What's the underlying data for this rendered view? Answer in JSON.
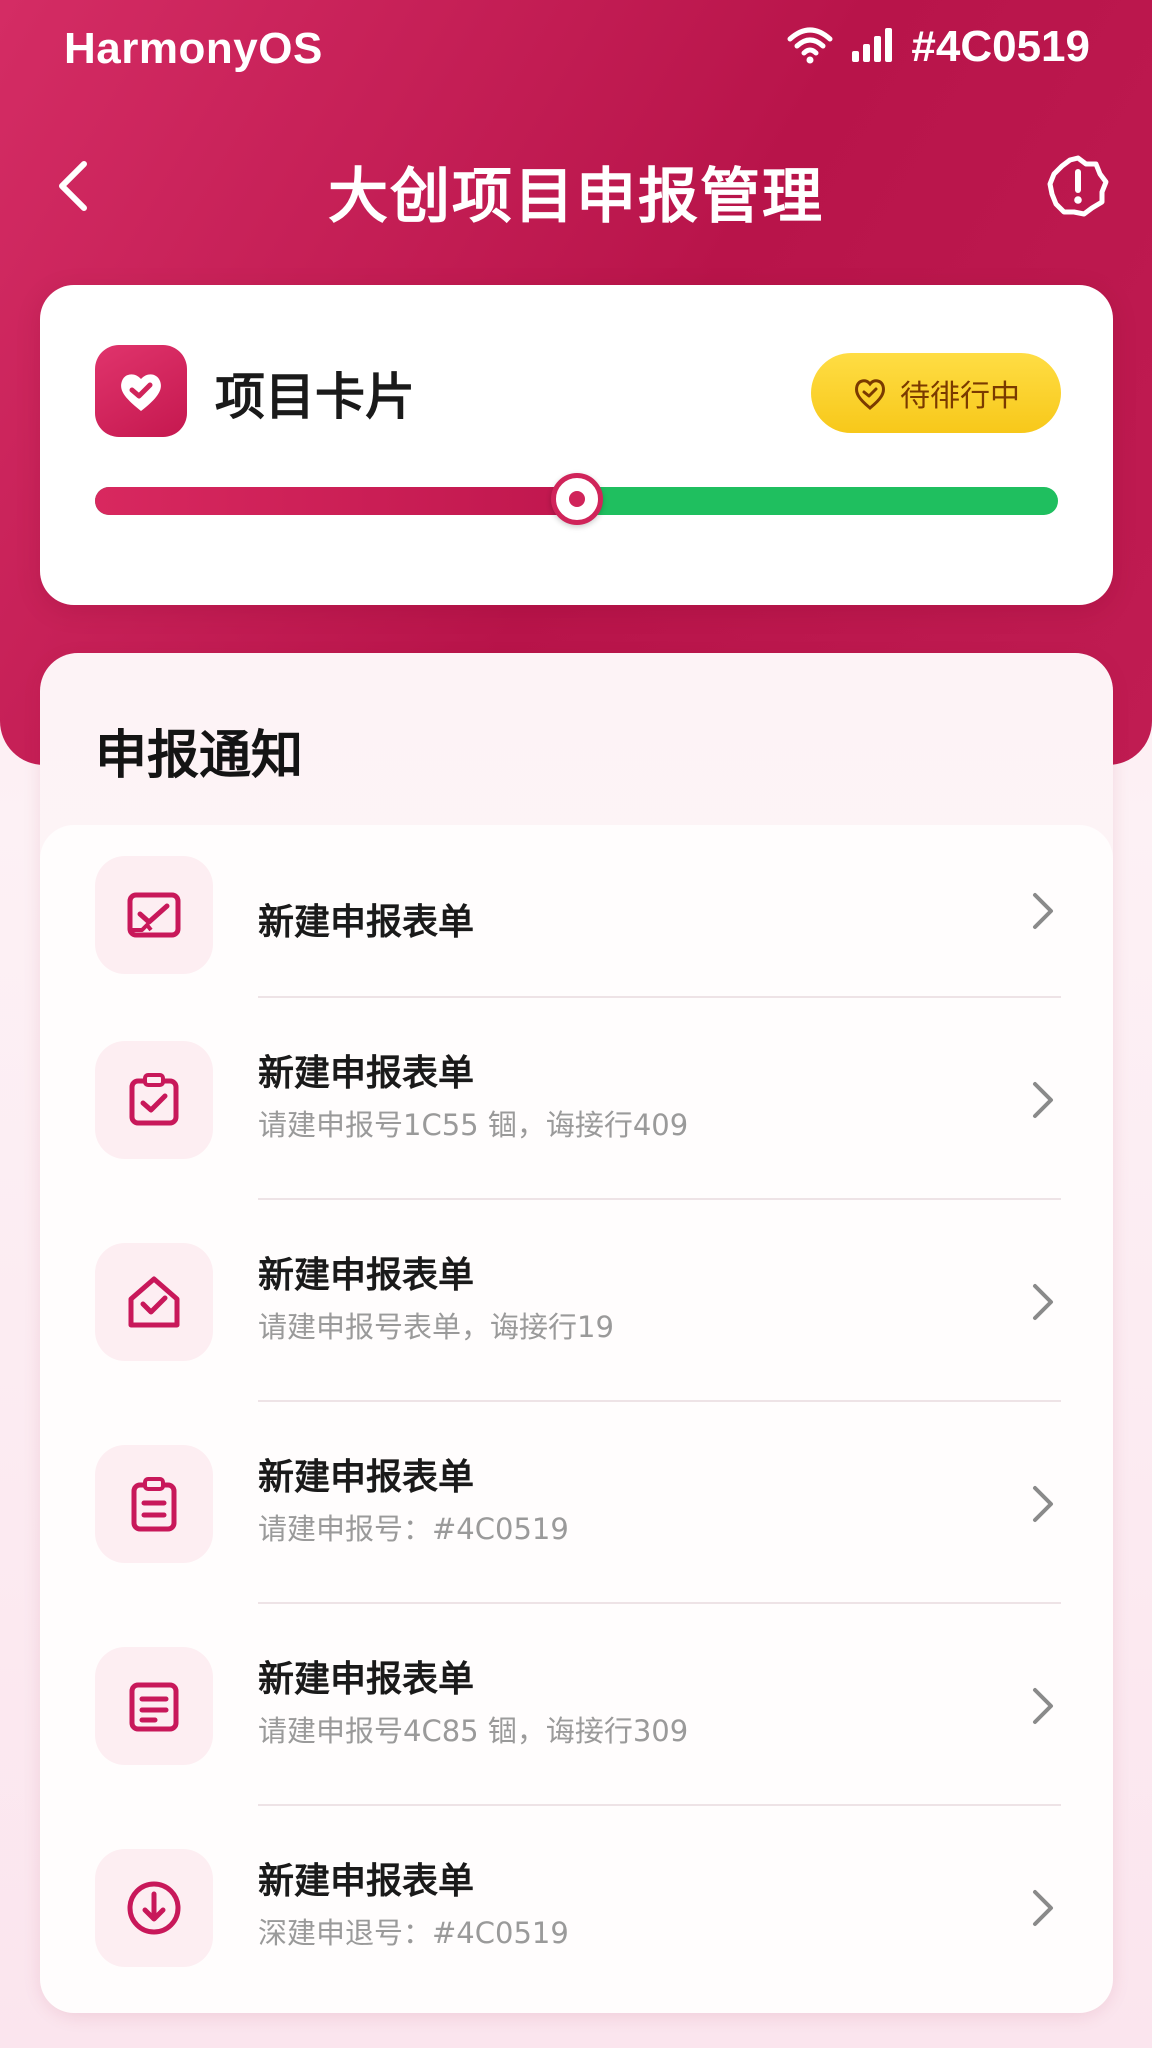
{
  "status_bar": {
    "brand": "HarmonyOS",
    "right_text": "#4C0519"
  },
  "header": {
    "title": "大创项目申报管理"
  },
  "project_card": {
    "title": "项目卡片",
    "status_label": "待徘行中",
    "progress": 0.5
  },
  "colors": {
    "accent": "#C8185A",
    "dark": "#4C0519",
    "success": "#1FBF5F",
    "badge": "#F7C81A"
  },
  "notices": {
    "section_title": "申报通知",
    "items": [
      {
        "title": "新建申报表单",
        "subtitle": "",
        "icon": "form-check-icon"
      },
      {
        "title": "新建申报表单",
        "subtitle": "请建申报号1C55 锢，诲接行409",
        "icon": "clipboard-check-icon"
      },
      {
        "title": "新建申报表单",
        "subtitle": "请建申报号表单，诲接行19",
        "icon": "home-check-icon"
      },
      {
        "title": "新建申报表单",
        "subtitle": "请建申报号：#4C0519",
        "icon": "clipboard-list-icon"
      },
      {
        "title": "新建申报表单",
        "subtitle": "请建申报号4C85 锢，诲接行309",
        "icon": "document-icon"
      },
      {
        "title": "新建申报表单",
        "subtitle": "深建申退号：#4C0519",
        "icon": "download-circle-icon"
      }
    ]
  }
}
